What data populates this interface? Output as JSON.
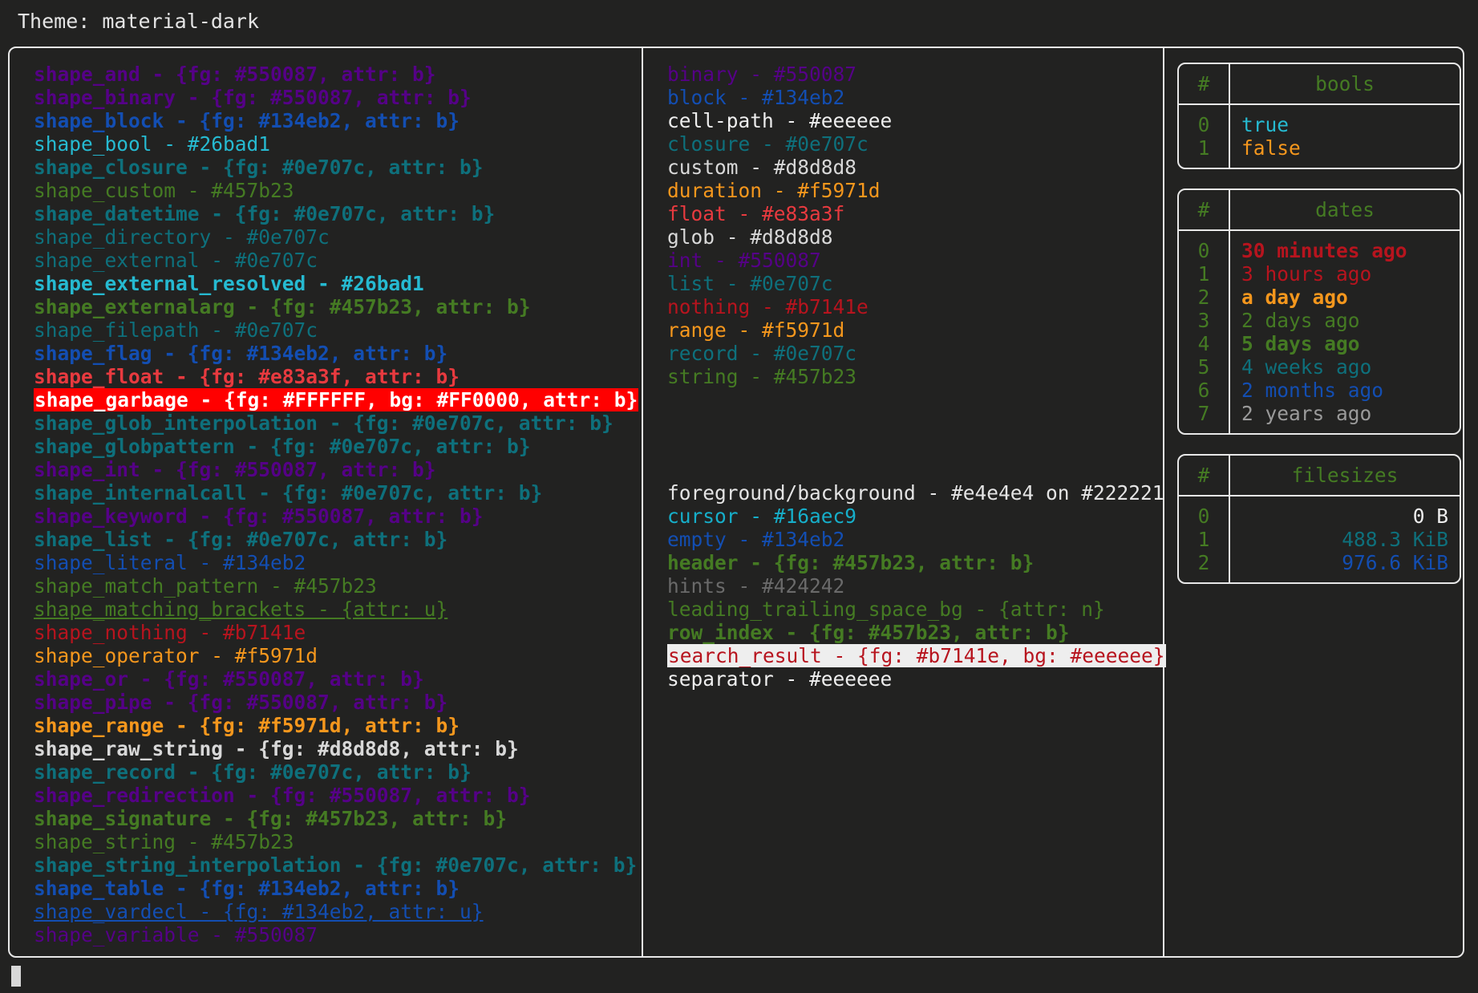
{
  "theme": {
    "label": "Theme:",
    "name": "material-dark",
    "line": "Theme: material-dark"
  },
  "colors": {
    "background": "#222221",
    "foreground": "#e4e4e4",
    "border": "#e8e8e8",
    "purple": "#550087",
    "blue": "#134eb2",
    "cyan": "#26bad1",
    "teal": "#0e707c",
    "green": "#457b23",
    "red": "#e83a3f",
    "dark_red": "#b7141e",
    "orange": "#f5971d",
    "white": "#d8d8d8",
    "light": "#eeeeee",
    "hint_gray": "#424242",
    "cursor": "#16aec9",
    "garbage_fg": "#FFFFFF",
    "garbage_bg": "#FF0000",
    "search_fg": "#b7141e",
    "search_bg": "#eeeeee"
  },
  "shapes": [
    {
      "text": "shape_and - {fg: #550087, attr: b}",
      "color": "#550087",
      "bold": true,
      "underline": false
    },
    {
      "text": "shape_binary - {fg: #550087, attr: b}",
      "color": "#550087",
      "bold": true,
      "underline": false
    },
    {
      "text": "shape_block - {fg: #134eb2, attr: b}",
      "color": "#134eb2",
      "bold": true,
      "underline": false
    },
    {
      "text": "shape_bool - #26bad1",
      "color": "#26bad1",
      "bold": false,
      "underline": false
    },
    {
      "text": "shape_closure - {fg: #0e707c, attr: b}",
      "color": "#0e707c",
      "bold": true,
      "underline": false
    },
    {
      "text": "shape_custom - #457b23",
      "color": "#457b23",
      "bold": false,
      "underline": false
    },
    {
      "text": "shape_datetime - {fg: #0e707c, attr: b}",
      "color": "#0e707c",
      "bold": true,
      "underline": false
    },
    {
      "text": "shape_directory - #0e707c",
      "color": "#0e707c",
      "bold": false,
      "underline": false
    },
    {
      "text": "shape_external - #0e707c",
      "color": "#0e707c",
      "bold": false,
      "underline": false
    },
    {
      "text": "shape_external_resolved - #26bad1",
      "color": "#26bad1",
      "bold": true,
      "underline": false
    },
    {
      "text": "shape_externalarg - {fg: #457b23, attr: b}",
      "color": "#457b23",
      "bold": true,
      "underline": false
    },
    {
      "text": "shape_filepath - #0e707c",
      "color": "#0e707c",
      "bold": false,
      "underline": false
    },
    {
      "text": "shape_flag - {fg: #134eb2, attr: b}",
      "color": "#134eb2",
      "bold": true,
      "underline": false
    },
    {
      "text": "shape_float - {fg: #e83a3f, attr: b}",
      "color": "#e83a3f",
      "bold": true,
      "underline": false
    },
    {
      "text": "shape_garbage - {fg: #FFFFFF, bg: #FF0000, attr: b}",
      "color": "#FFFFFF",
      "bg": "#FF0000",
      "bold": true,
      "underline": false
    },
    {
      "text": "shape_glob_interpolation - {fg: #0e707c, attr: b}",
      "color": "#0e707c",
      "bold": true,
      "underline": false
    },
    {
      "text": "shape_globpattern - {fg: #0e707c, attr: b}",
      "color": "#0e707c",
      "bold": true,
      "underline": false
    },
    {
      "text": "shape_int - {fg: #550087, attr: b}",
      "color": "#550087",
      "bold": true,
      "underline": false
    },
    {
      "text": "shape_internalcall - {fg: #0e707c, attr: b}",
      "color": "#0e707c",
      "bold": true,
      "underline": false
    },
    {
      "text": "shape_keyword - {fg: #550087, attr: b}",
      "color": "#550087",
      "bold": true,
      "underline": false
    },
    {
      "text": "shape_list - {fg: #0e707c, attr: b}",
      "color": "#0e707c",
      "bold": true,
      "underline": false
    },
    {
      "text": "shape_literal - #134eb2",
      "color": "#134eb2",
      "bold": false,
      "underline": false
    },
    {
      "text": "shape_match_pattern - #457b23",
      "color": "#457b23",
      "bold": false,
      "underline": false
    },
    {
      "text": "shape_matching_brackets - {attr: u}",
      "color": "#457b23",
      "bold": false,
      "underline": true
    },
    {
      "text": "shape_nothing - #b7141e",
      "color": "#b7141e",
      "bold": false,
      "underline": false
    },
    {
      "text": "shape_operator - #f5971d",
      "color": "#f5971d",
      "bold": false,
      "underline": false
    },
    {
      "text": "shape_or - {fg: #550087, attr: b}",
      "color": "#550087",
      "bold": true,
      "underline": false
    },
    {
      "text": "shape_pipe - {fg: #550087, attr: b}",
      "color": "#550087",
      "bold": true,
      "underline": false
    },
    {
      "text": "shape_range - {fg: #f5971d, attr: b}",
      "color": "#f5971d",
      "bold": true,
      "underline": false
    },
    {
      "text": "shape_raw_string - {fg: #d8d8d8, attr: b}",
      "color": "#d8d8d8",
      "bold": true,
      "underline": false
    },
    {
      "text": "shape_record - {fg: #0e707c, attr: b}",
      "color": "#0e707c",
      "bold": true,
      "underline": false
    },
    {
      "text": "shape_redirection - {fg: #550087, attr: b}",
      "color": "#550087",
      "bold": true,
      "underline": false
    },
    {
      "text": "shape_signature - {fg: #457b23, attr: b}",
      "color": "#457b23",
      "bold": true,
      "underline": false
    },
    {
      "text": "shape_string - #457b23",
      "color": "#457b23",
      "bold": false,
      "underline": false
    },
    {
      "text": "shape_string_interpolation - {fg: #0e707c, attr: b}",
      "color": "#0e707c",
      "bold": true,
      "underline": false
    },
    {
      "text": "shape_table - {fg: #134eb2, attr: b}",
      "color": "#134eb2",
      "bold": true,
      "underline": false
    },
    {
      "text": "shape_vardecl - {fg: #134eb2, attr: u}",
      "color": "#134eb2",
      "bold": false,
      "underline": true
    },
    {
      "text": "shape_variable - #550087",
      "color": "#550087",
      "bold": false,
      "underline": false
    }
  ],
  "types": [
    {
      "text": "binary - #550087",
      "color": "#550087",
      "bold": false,
      "underline": false
    },
    {
      "text": "block - #134eb2",
      "color": "#134eb2",
      "bold": false,
      "underline": false
    },
    {
      "text": "cell-path - #eeeeee",
      "color": "#eeeeee",
      "bold": false,
      "underline": false
    },
    {
      "text": "closure - #0e707c",
      "color": "#0e707c",
      "bold": false,
      "underline": false
    },
    {
      "text": "custom - #d8d8d8",
      "color": "#d8d8d8",
      "bold": false,
      "underline": false
    },
    {
      "text": "duration - #f5971d",
      "color": "#f5971d",
      "bold": false,
      "underline": false
    },
    {
      "text": "float - #e83a3f",
      "color": "#e83a3f",
      "bold": false,
      "underline": false
    },
    {
      "text": "glob - #d8d8d8",
      "color": "#d8d8d8",
      "bold": false,
      "underline": false
    },
    {
      "text": "int - #550087",
      "color": "#550087",
      "bold": false,
      "underline": false
    },
    {
      "text": "list - #0e707c",
      "color": "#0e707c",
      "bold": false,
      "underline": false
    },
    {
      "text": "nothing - #b7141e",
      "color": "#b7141e",
      "bold": false,
      "underline": false
    },
    {
      "text": "range - #f5971d",
      "color": "#f5971d",
      "bold": false,
      "underline": false
    },
    {
      "text": "record - #0e707c",
      "color": "#0e707c",
      "bold": false,
      "underline": false
    },
    {
      "text": "string - #457b23",
      "color": "#457b23",
      "bold": false,
      "underline": false
    }
  ],
  "ui_elements": [
    {
      "text": "foreground/background - #e4e4e4 on #222221",
      "color": "#e4e4e4",
      "bold": false,
      "underline": false
    },
    {
      "text": "cursor - #16aec9",
      "color": "#16aec9",
      "bold": false,
      "underline": false
    },
    {
      "text": "empty - #134eb2",
      "color": "#134eb2",
      "bold": false,
      "underline": false
    },
    {
      "text": "header - {fg: #457b23, attr: b}",
      "color": "#457b23",
      "bold": true,
      "underline": false
    },
    {
      "text": "hints - #424242",
      "color": "#6a6a6a",
      "bold": false,
      "underline": false
    },
    {
      "text": "leading_trailing_space_bg - {attr: n}",
      "color": "#457b23",
      "bold": false,
      "underline": false
    },
    {
      "text": "row_index - {fg: #457b23, attr: b}",
      "color": "#457b23",
      "bold": true,
      "underline": false
    },
    {
      "text": "search_result - {fg: #b7141e, bg: #eeeeee}",
      "color": "#b7141e",
      "bg": "#eeeeee",
      "bold": false,
      "underline": false
    },
    {
      "text": "separator - #eeeeee",
      "color": "#eeeeee",
      "bold": false,
      "underline": false
    }
  ],
  "tables": [
    {
      "name": "bools",
      "headers": [
        "#",
        "bools"
      ],
      "align": "center",
      "rows": [
        {
          "index": "0",
          "value": "true",
          "color": "#26bad1",
          "bold": false
        },
        {
          "index": "1",
          "value": "false",
          "color": "#f5971d",
          "bold": false
        }
      ]
    },
    {
      "name": "dates",
      "headers": [
        "#",
        "dates"
      ],
      "align": "center",
      "rows": [
        {
          "index": "0",
          "value": "30 minutes ago",
          "color": "#b7141e",
          "bold": true
        },
        {
          "index": "1",
          "value": "3 hours ago",
          "color": "#b7141e",
          "bold": false
        },
        {
          "index": "2",
          "value": "a day ago",
          "color": "#f5971d",
          "bold": true
        },
        {
          "index": "3",
          "value": "2 days ago",
          "color": "#457b23",
          "bold": false
        },
        {
          "index": "4",
          "value": "5 days ago",
          "color": "#457b23",
          "bold": true
        },
        {
          "index": "5",
          "value": "4 weeks ago",
          "color": "#0e707c",
          "bold": false
        },
        {
          "index": "6",
          "value": "2 months ago",
          "color": "#134eb2",
          "bold": false
        },
        {
          "index": "7",
          "value": "2 years ago",
          "color": "#9a9a9a",
          "bold": false
        }
      ]
    },
    {
      "name": "filesizes",
      "headers": [
        "#",
        "filesizes"
      ],
      "align": "right",
      "rows": [
        {
          "index": "0",
          "value": "0 B",
          "color": "#eeeeee",
          "bold": false
        },
        {
          "index": "1",
          "value": "488.3 KiB",
          "color": "#0e707c",
          "bold": false
        },
        {
          "index": "2",
          "value": "976.6 KiB",
          "color": "#134eb2",
          "bold": false
        }
      ]
    }
  ]
}
